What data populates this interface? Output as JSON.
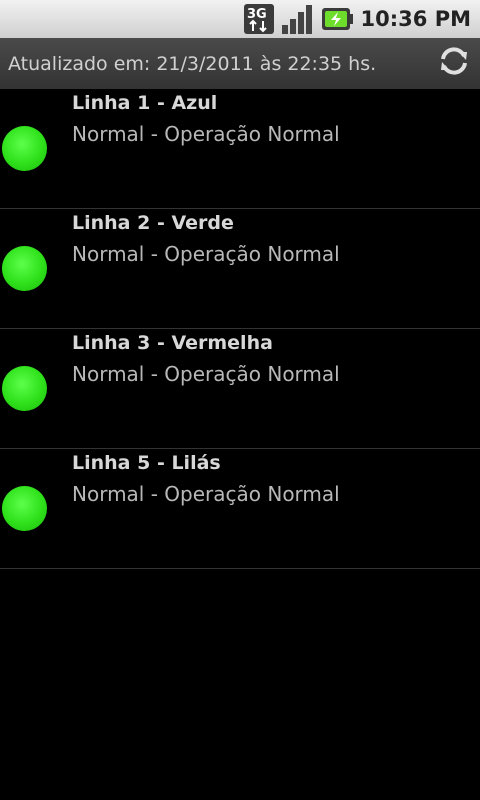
{
  "status_bar": {
    "network_icon": "3g-icon",
    "signal_icon": "signal-bars-icon",
    "battery_icon": "battery-charging-icon",
    "time": "10:36 PM"
  },
  "header": {
    "updated_text": "Atualizado em: 21/3/2011 às 22:35 hs.",
    "refresh_icon": "refresh-icon"
  },
  "lines": [
    {
      "title": "Linha 1 - Azul",
      "status": "Normal - Operação Normal",
      "indicator_color": "#2ee01a"
    },
    {
      "title": "Linha 2 - Verde",
      "status": "Normal - Operação Normal",
      "indicator_color": "#2ee01a"
    },
    {
      "title": "Linha 3 - Vermelha",
      "status": "Normal - Operação Normal",
      "indicator_color": "#2ee01a"
    },
    {
      "title": "Linha 5 - Lilás",
      "status": "Normal - Operação Normal",
      "indicator_color": "#2ee01a"
    }
  ]
}
